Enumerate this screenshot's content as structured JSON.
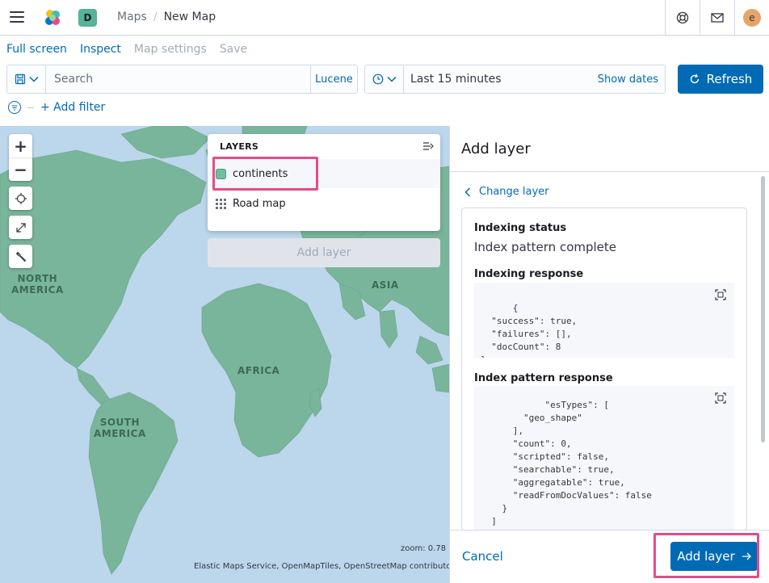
{
  "header": {
    "space_initial": "D",
    "breadcrumbs": [
      "Maps",
      "New Map"
    ],
    "breadcrumb_separator": "/",
    "user_initial": "e",
    "icons": [
      "menu-icon",
      "elastic-logo",
      "help-icon",
      "mail-icon"
    ]
  },
  "topnav": {
    "full_screen": "Full screen",
    "inspect": "Inspect",
    "map_settings": "Map settings",
    "save": "Save"
  },
  "querybar": {
    "search_placeholder": "Search",
    "language": "Lucene"
  },
  "datepicker": {
    "range": "Last 15 minutes",
    "show_dates": "Show dates"
  },
  "refresh_label": "Refresh",
  "filter": {
    "add_filter": "+ Add filter"
  },
  "map": {
    "labels": {
      "north_america": "NORTH\nAMERICA",
      "south_america": "SOUTH\nAMERICA",
      "africa": "AFRICA",
      "asia": "ASIA"
    },
    "zoom_text": "zoom: 0.78",
    "attribution": "Elastic Maps Service, OpenMapTiles, OpenStreetMap contributors",
    "land_color": "#79b59a",
    "water_color": "#bcd6ec"
  },
  "layers_panel": {
    "title": "LAYERS",
    "items": [
      {
        "label": "continents",
        "icon": "swatch-green"
      },
      {
        "label": "Road map",
        "icon": "grid-icon"
      }
    ],
    "add_layer": "Add layer"
  },
  "flyout": {
    "title": "Add layer",
    "change_layer": "Change layer",
    "indexing_status_title": "Indexing status",
    "indexing_status_value": "Index pattern complete",
    "indexing_response_title": "Indexing response",
    "indexing_response_code": "{\n  \"success\": true,\n  \"failures\": [],\n  \"docCount\": 8\n}",
    "index_pattern_response_title": "Index pattern response",
    "index_pattern_response_code": "      \"esTypes\": [\n        \"geo_shape\"\n      ],\n      \"count\": 0,\n      \"scripted\": false,\n      \"searchable\": true,\n      \"aggregatable\": true,\n      \"readFromDocValues\": false\n    }\n  ]\n}",
    "cancel": "Cancel",
    "add_layer_button": "Add layer"
  },
  "colors": {
    "primary": "#006bb4",
    "highlight": "#e54c87"
  }
}
